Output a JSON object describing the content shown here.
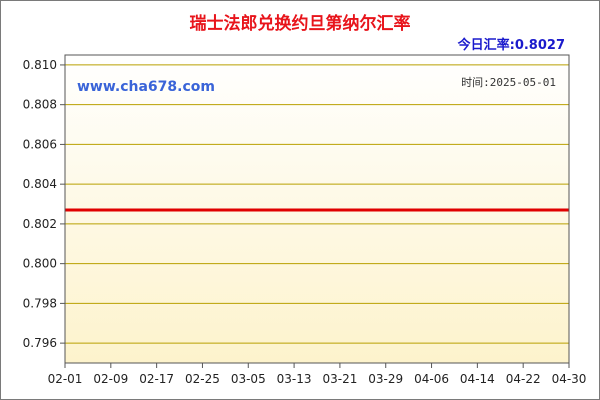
{
  "header": {
    "title": "瑞士法郎兑换约旦第纳尔汇率",
    "today_rate": "今日汇率:0.8027"
  },
  "watermark": "www.cha678.com",
  "time_label": "时间:2025-05-01",
  "colors": {
    "title": "#e8141b",
    "today": "#1a1acc",
    "watermark": "#3a64d8",
    "series": "#e00000",
    "plot_bg_top": "#ffffff",
    "plot_bg_bottom": "#fdf3cc",
    "grid": "#b9a000"
  },
  "chart_data": {
    "type": "line",
    "ylim": [
      0.795,
      0.8105
    ],
    "y_ticks": [
      "0.810",
      "0.808",
      "0.806",
      "0.804",
      "0.802",
      "0.800",
      "0.798",
      "0.796"
    ],
    "x_ticks": [
      "02-01",
      "02-09",
      "02-17",
      "02-25",
      "03-05",
      "03-13",
      "03-21",
      "03-29",
      "04-06",
      "04-14",
      "04-22",
      "04-30"
    ],
    "grid": true,
    "series": [
      {
        "x": [
          "02-01",
          "04-30"
        ],
        "values": [
          0.8027,
          0.8027
        ]
      }
    ]
  }
}
